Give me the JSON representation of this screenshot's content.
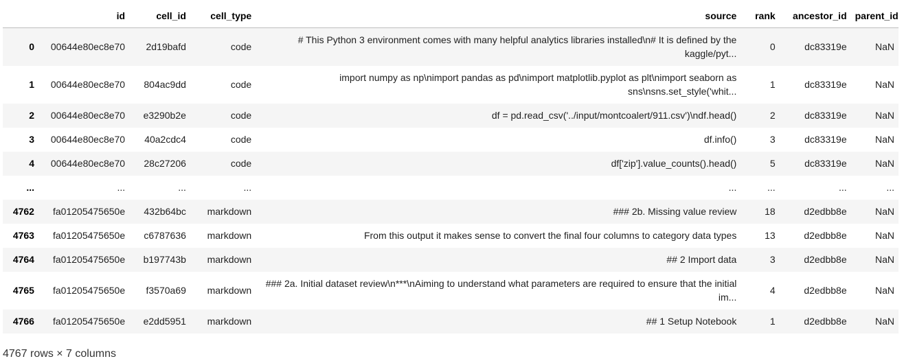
{
  "table": {
    "columns": [
      "",
      "id",
      "cell_id",
      "cell_type",
      "source",
      "rank",
      "ancestor_id",
      "parent_id"
    ],
    "rows": [
      {
        "index": "0",
        "id": "00644e80ec8e70",
        "cell_id": "2d19bafd",
        "cell_type": "code",
        "source": "# This Python 3 environment comes with many helpful analytics libraries installed\\n# It is defined by the kaggle/pyt...",
        "rank": "0",
        "ancestor_id": "dc83319e",
        "parent_id": "NaN",
        "tall": true
      },
      {
        "index": "1",
        "id": "00644e80ec8e70",
        "cell_id": "804ac9dd",
        "cell_type": "code",
        "source": "import numpy as np\\nimport pandas as pd\\nimport matplotlib.pyplot as plt\\nimport seaborn as sns\\nsns.set_style('whit...",
        "rank": "1",
        "ancestor_id": "dc83319e",
        "parent_id": "NaN",
        "tall": true
      },
      {
        "index": "2",
        "id": "00644e80ec8e70",
        "cell_id": "e3290b2e",
        "cell_type": "code",
        "source": "df = pd.read_csv('../input/montcoalert/911.csv')\\ndf.head()",
        "rank": "2",
        "ancestor_id": "dc83319e",
        "parent_id": "NaN",
        "tall": false
      },
      {
        "index": "3",
        "id": "00644e80ec8e70",
        "cell_id": "40a2cdc4",
        "cell_type": "code",
        "source": "df.info()",
        "rank": "3",
        "ancestor_id": "dc83319e",
        "parent_id": "NaN",
        "tall": false
      },
      {
        "index": "4",
        "id": "00644e80ec8e70",
        "cell_id": "28c27206",
        "cell_type": "code",
        "source": "df['zip'].value_counts().head()",
        "rank": "5",
        "ancestor_id": "dc83319e",
        "parent_id": "NaN",
        "tall": false
      },
      {
        "index": "...",
        "id": "...",
        "cell_id": "...",
        "cell_type": "...",
        "source": "...",
        "rank": "...",
        "ancestor_id": "...",
        "parent_id": "...",
        "tall": false
      },
      {
        "index": "4762",
        "id": "fa01205475650e",
        "cell_id": "432b64bc",
        "cell_type": "markdown",
        "source": "### 2b. Missing value review",
        "rank": "18",
        "ancestor_id": "d2edbb8e",
        "parent_id": "NaN",
        "tall": false
      },
      {
        "index": "4763",
        "id": "fa01205475650e",
        "cell_id": "c6787636",
        "cell_type": "markdown",
        "source": "From this output it makes sense to convert the final four columns to category data types",
        "rank": "13",
        "ancestor_id": "d2edbb8e",
        "parent_id": "NaN",
        "tall": false
      },
      {
        "index": "4764",
        "id": "fa01205475650e",
        "cell_id": "b197743b",
        "cell_type": "markdown",
        "source": "## 2 Import data",
        "rank": "3",
        "ancestor_id": "d2edbb8e",
        "parent_id": "NaN",
        "tall": false
      },
      {
        "index": "4765",
        "id": "fa01205475650e",
        "cell_id": "f3570a69",
        "cell_type": "markdown",
        "source": "### 2a. Initial dataset review\\n***\\nAiming to understand what parameters are required to ensure that the initial im...",
        "rank": "4",
        "ancestor_id": "d2edbb8e",
        "parent_id": "NaN",
        "tall": true
      },
      {
        "index": "4766",
        "id": "fa01205475650e",
        "cell_id": "e2dd5951",
        "cell_type": "markdown",
        "source": "## 1 Setup Notebook",
        "rank": "1",
        "ancestor_id": "d2edbb8e",
        "parent_id": "NaN",
        "tall": false
      }
    ]
  },
  "footer": {
    "shape_text": "4767 rows × 7 columns"
  }
}
